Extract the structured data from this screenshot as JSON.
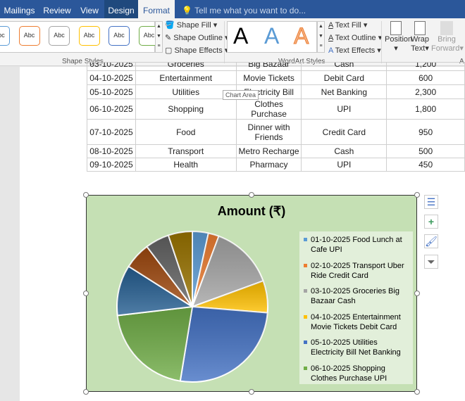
{
  "ribbon_tabs": [
    "Mailings",
    "Review",
    "View",
    "Design",
    "Format"
  ],
  "active_tab": "Format",
  "tell_me": "Tell me what you want to do...",
  "shape_styles": {
    "sample": "Abc",
    "colors": [
      "#5b9bd5",
      "#ed7d31",
      "#a5a5a5",
      "#ffc000",
      "#4472c4",
      "#70ad47"
    ],
    "fill": "Shape Fill",
    "outline": "Shape Outline",
    "effects": "Shape Effects",
    "group": "Shape Styles"
  },
  "wordart": {
    "sample": "A",
    "fill": "Text Fill",
    "outline": "Text Outline",
    "effects": "Text Effects",
    "group": "WordArt Styles"
  },
  "arrange": {
    "position": "Position",
    "wrap": "Wrap",
    "wrap2": "Text",
    "bring": "Bring",
    "bring2": "Forward",
    "group": "A"
  },
  "table": {
    "rows": [
      [
        "03-10-2025",
        "Groceries",
        "Big Bazaar",
        "Cash",
        "1,200"
      ],
      [
        "04-10-2025",
        "Entertainment",
        "Movie Tickets",
        "Debit Card",
        "600"
      ],
      [
        "05-10-2025",
        "Utilities",
        "Electricity Bill",
        "Net Banking",
        "2,300"
      ],
      [
        "06-10-2025",
        "Shopping",
        "Clothes Purchase",
        "UPI",
        "1,800"
      ],
      [
        "07-10-2025",
        "Food",
        "Dinner with Friends",
        "Credit Card",
        "950"
      ],
      [
        "08-10-2025",
        "Transport",
        "Metro Recharge",
        "Cash",
        "500"
      ],
      [
        "09-10-2025",
        "Health",
        "Pharmacy",
        "UPI",
        "450"
      ]
    ]
  },
  "tooltip": "Chart Area",
  "chart_data": {
    "type": "pie",
    "title": "Amount (₹)",
    "categories": [
      "01-10-2025 Food Lunch at Cafe UPI",
      "02-10-2025 Transport Uber Ride Credit Card",
      "03-10-2025 Groceries Big Bazaar Cash",
      "04-10-2025 Entertainment Movie Tickets Debit Card",
      "05-10-2025 Utilities Electricity Bill Net Banking",
      "06-10-2025 Shopping Clothes Purchase UPI"
    ],
    "values": [
      300,
      200,
      1200,
      600,
      2300,
      1800,
      950,
      500,
      450,
      450
    ],
    "colors": [
      "#5b9bd5",
      "#ed7d31",
      "#a5a5a5",
      "#ffc000",
      "#4472c4",
      "#70ad47",
      "#255e91",
      "#9e480e",
      "#636363",
      "#997300"
    ],
    "legend": "right"
  },
  "chart_buttons": [
    "layout-options-icon",
    "chart-elements-icon",
    "chart-styles-icon",
    "chart-filters-icon"
  ]
}
